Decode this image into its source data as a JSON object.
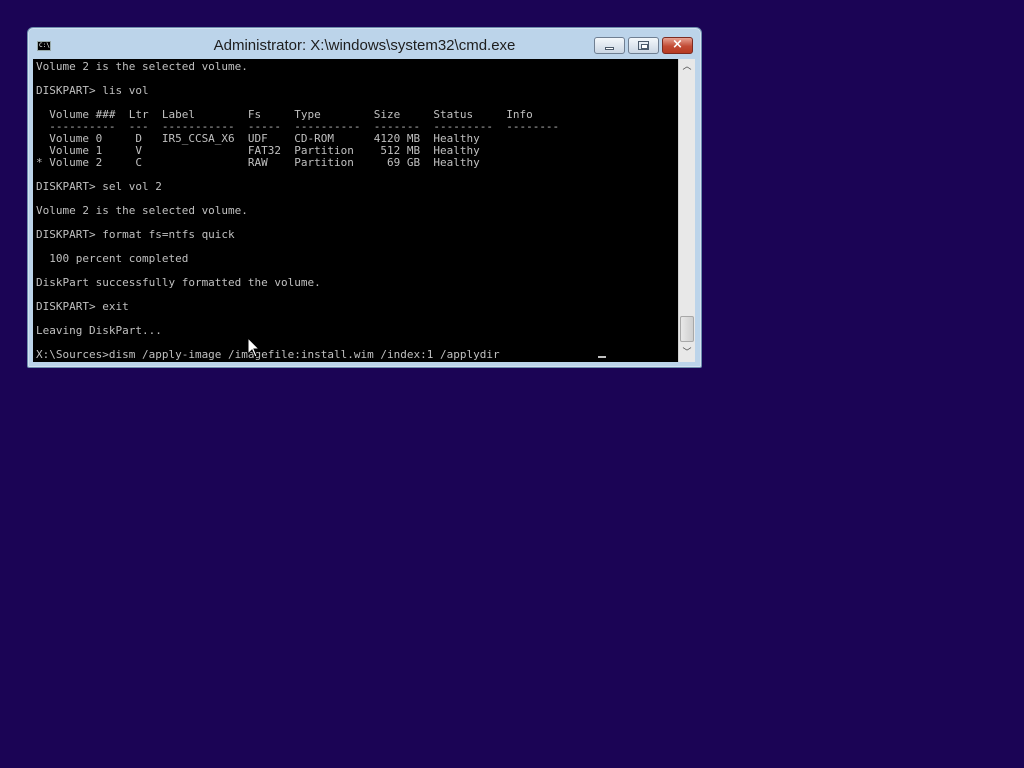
{
  "window": {
    "title": "Administrator: X:\\windows\\system32\\cmd.exe",
    "icon_text": "C:\\",
    "buttons": {
      "minimize": "minimize-icon",
      "maximize": "maximize-icon",
      "close": "×"
    }
  },
  "console": {
    "lines": [
      "Volume 2 is the selected volume.",
      "",
      "DISKPART> lis vol",
      "",
      "  Volume ###  Ltr  Label        Fs     Type        Size     Status     Info",
      "  ----------  ---  -----------  -----  ----------  -------  ---------  --------",
      "  Volume 0     D   IR5_CCSA_X6  UDF    CD-ROM      4120 MB  Healthy",
      "  Volume 1     V                FAT32  Partition    512 MB  Healthy",
      "* Volume 2     C                RAW    Partition     69 GB  Healthy",
      "",
      "DISKPART> sel vol 2",
      "",
      "Volume 2 is the selected volume.",
      "",
      "DISKPART> format fs=ntfs quick",
      "",
      "  100 percent completed",
      "",
      "DiskPart successfully formatted the volume.",
      "",
      "DISKPART> exit",
      "",
      "Leaving DiskPart...",
      "",
      "X:\\Sources>dism /apply-image /imagefile:install.wim /index:1 /applydir"
    ]
  },
  "colors": {
    "desktop": "#1b0455",
    "console_bg": "#000000",
    "console_fg": "#c0c0c0"
  }
}
